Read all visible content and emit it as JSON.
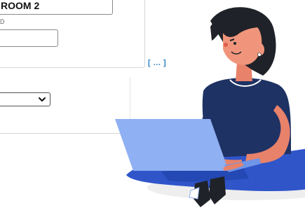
{
  "form": {
    "room_value": "ROOM 2",
    "small_label": "D",
    "text_value": "",
    "select_value": "",
    "more_link": "[ ... ]"
  },
  "icons": {
    "select_chevron": "chevron-down-icon"
  },
  "colors": {
    "link": "#2a7fc0",
    "shirt": "#1f3264",
    "pants": "#2f55c9",
    "laptop": "#8fb0f2",
    "skin": "#e8826a",
    "hair": "#1f2228",
    "floor_shadow": "#eeeeee"
  }
}
